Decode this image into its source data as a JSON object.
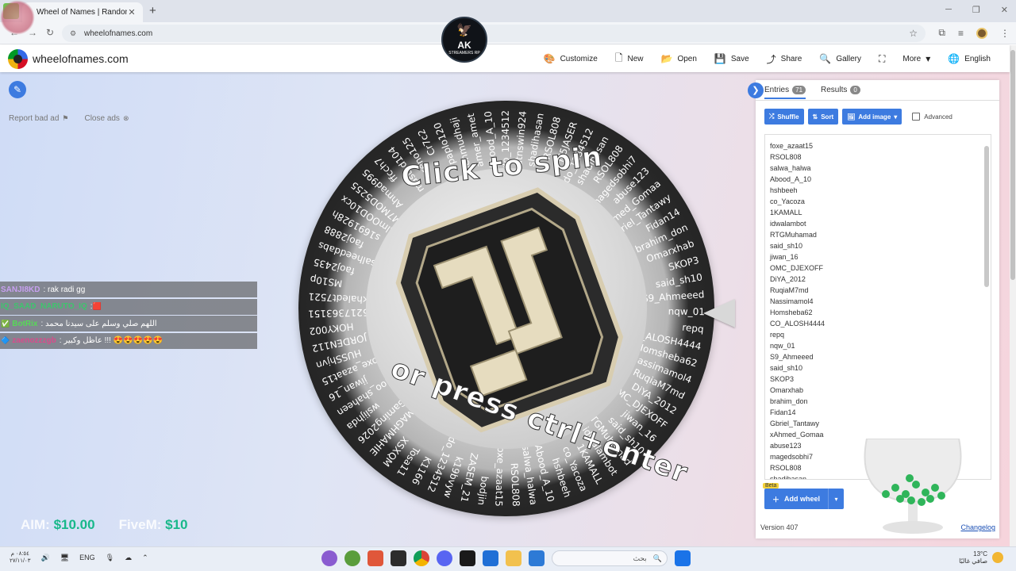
{
  "browser": {
    "tab_title": "Wheel of Names | Random nam",
    "url": "wheelofnames.com"
  },
  "header": {
    "brand": "wheelofnames.com",
    "menu": [
      {
        "label": "Customize",
        "icon": "palette-icon"
      },
      {
        "label": "New",
        "icon": "document-icon"
      },
      {
        "label": "Open",
        "icon": "folder-icon"
      },
      {
        "label": "Save",
        "icon": "floppy-icon"
      },
      {
        "label": "Share",
        "icon": "share-icon"
      },
      {
        "label": "Gallery",
        "icon": "search-icon"
      },
      {
        "label": "",
        "icon": "fullscreen-icon"
      },
      {
        "label": "More",
        "icon": "chevron-down-icon"
      },
      {
        "label": "English",
        "icon": "globe-icon"
      }
    ]
  },
  "ads": {
    "report": "Report bad ad",
    "close": "Close ads"
  },
  "overlay_logo": {
    "title": "AK",
    "subtitle": "STREAMERS RP"
  },
  "chat": [
    {
      "user": "SANJI8KD",
      "color": "#c7a0f0",
      "text": ": rak radi gg"
    },
    {
      "user": "IQ_SAAD_NARUTO_IQ",
      "color": "#3ec46d",
      "text": ":"
    },
    {
      "user": "BotRix",
      "color": "#57d957",
      "text": ": اللهم صلي وسلم على سيدنا محمد"
    },
    {
      "user": "zaenozzzgb",
      "color": "#d94b8c",
      "text": ": عاظل وكبير !!! 😍😍😍😍😍"
    }
  ],
  "stats": {
    "label1": "AIM:",
    "value1": "$10.00",
    "label2": "FiveM:",
    "value2": "$10"
  },
  "wheel": {
    "prompt_top": "Click to spin",
    "prompt_bottom": "or press ctrl+enter",
    "names": [
      "M5JASER",
      "Dodo_1234512",
      "shadihasan",
      "RSOL808",
      "magedsobhi7",
      "abuse123",
      "xAhmed_Gomaa",
      "Gbriel_Tantawy",
      "Fidan14",
      "brahim_don",
      "Omarxhab",
      "SKOP3",
      "said_sh10",
      "S9_Ahmeeed",
      "nqw_01",
      "repq",
      "CO_ALOSH4444",
      "Homsheba62",
      "Nassimamol4",
      "RuqiaM7md",
      "DiYA_2012",
      "OMC_DJEXOFF",
      "jiwan_16",
      "said_sh10",
      "RTGMuhamad",
      "idwalambot",
      "1KAMALL",
      "co_Yacoza",
      "hshbeeh",
      "Abood_A_10",
      "salwa_halwa",
      "RSOL808",
      "foxe_azaat15",
      "bodjin",
      "ZASEM_21",
      "k19bvyw",
      "Dodo_1234512",
      "K1166",
      "Tosa11",
      "XSXQM",
      "AMAGHMAHIE",
      "Hassan_Gaming2026",
      "wslijhda",
      "joo_shaheen",
      "jiwan_16",
      "foxe_azaat15",
      "HUSShjvn",
      "JORDEN112",
      "HOKY002",
      "5217363151",
      "khaledt7521",
      "MS10p",
      "faoj2435",
      "salheeddabs",
      "faoj2888",
      "s1691928h",
      "AlmOOD10cx",
      "M7MOD5255",
      "Ahmad995",
      "ffcch7",
      "masted104",
      "reno125",
      "Cr7c2",
      "paplo120",
      "mehmudhaji",
      "amer_amet",
      "Abood_A_10",
      "Dodo_1234512",
      "ahmedtnswin924",
      "shadihasan",
      "RSOL808"
    ]
  },
  "panel": {
    "tab_entries": "Entries",
    "entries_count": "71",
    "tab_results": "Results",
    "results_count": "0",
    "shuffle": "Shuffle",
    "sort": "Sort",
    "add_image": "Add image",
    "advanced": "Advanced",
    "entries": [
      "foxe_azaat15",
      "RSOL808",
      "salwa_halwa",
      "Abood_A_10",
      "hshbeeh",
      "co_Yacoza",
      "1KAMALL",
      "idwalambot",
      "RTGMuhamad",
      "said_sh10",
      "jiwan_16",
      "OMC_DJEXOFF",
      "DiYA_2012",
      "RuqiaM7md",
      "Nassimamol4",
      "Homsheba62",
      "CO_ALOSH4444",
      "repq",
      "nqw_01",
      "S9_Ahmeeed",
      "said_sh10",
      "SKOP3",
      "Omarxhab",
      "brahim_don",
      "Fidan14",
      "Gbriel_Tantawy",
      "xAhmed_Gomaa",
      "abuse123",
      "magedsobhi7",
      "RSOL808",
      "shadihasan"
    ],
    "beta": "Beta",
    "add_wheel": "Add wheel",
    "version": "Version 407",
    "changelog": "Changelog"
  },
  "taskbar": {
    "time": "٠٨:٥٤ م",
    "date": "٢٧/١١/٠٣",
    "lang": "ENG",
    "search_placeholder": "بحث",
    "temp": "13°C",
    "weather": "صافي غالبًا"
  }
}
